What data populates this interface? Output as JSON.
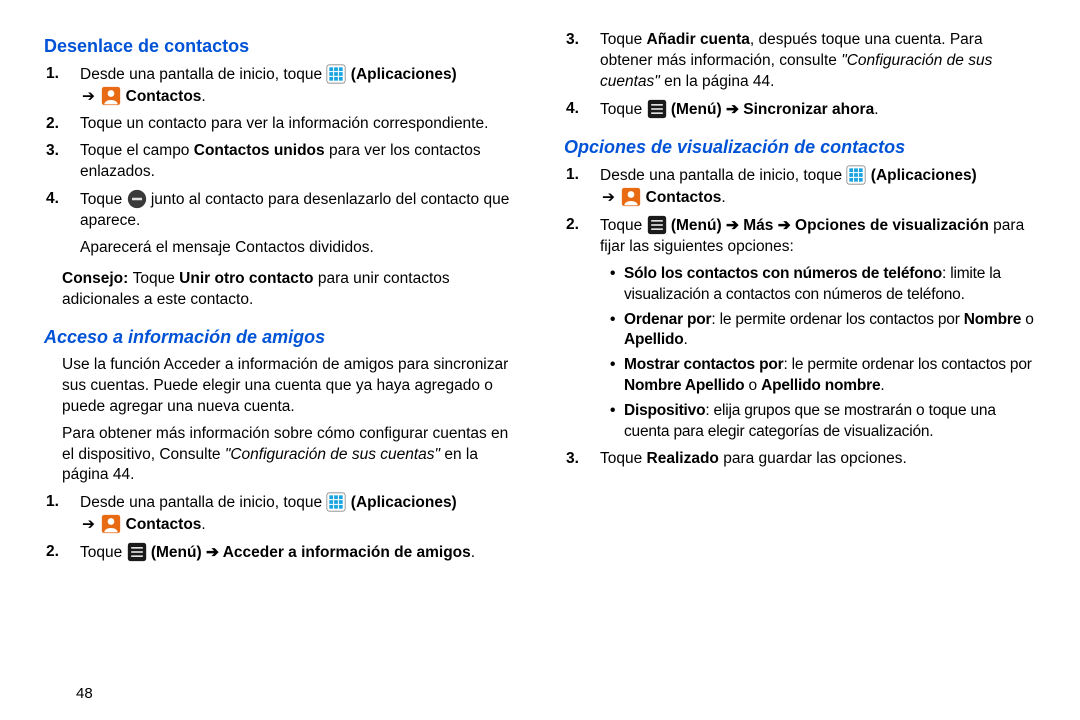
{
  "left": {
    "h1": "Desenlace de contactos",
    "s1_a": "Desde una pantalla de inicio, toque ",
    "s1_apps": " (Aplicaciones)",
    "s1_b": " ",
    "s1_cont": " Contactos",
    "s1_dot": ".",
    "s2": "Toque un contacto para ver la información correspondiente.",
    "s3_a": "Toque el campo ",
    "s3_b": "Contactos unidos",
    "s3_c": " para ver los contactos enlazados.",
    "s4_a": "Toque ",
    "s4_b": " junto al contacto para desenlazarlo del contacto que aparece.",
    "s4_msg": "Aparecerá el mensaje Contactos divididos.",
    "tip_label": "Consejo: ",
    "tip_a": "Toque ",
    "tip_b": "Unir otro contacto",
    "tip_c": " para unir contactos adicionales a este contacto.",
    "h2": "Acceso a información de amigos",
    "p1": "Use la función Acceder a información de amigos para sincronizar sus cuentas. Puede elegir una cuenta que ya haya agregado o puede agregar una nueva cuenta.",
    "p2_a": "Para obtener más información sobre cómo configurar cuentas en el dispositivo, Consulte ",
    "p2_b": "\"Configuración de sus cuentas\"",
    "p2_c": " en la página 44.",
    "s5_a": "Desde una pantalla de inicio, toque ",
    "s5_apps": " (Aplicaciones)",
    "s5_b": " ",
    "s5_cont": " Contactos",
    "s5_dot": ".",
    "s6_a": "Toque ",
    "s6_menu": " (Menú) ",
    "s6_b": " Acceder a información de amigos",
    "s6_dot": "."
  },
  "right": {
    "r3_a": "Toque ",
    "r3_b": "Añadir cuenta",
    "r3_c": ", después toque una cuenta. Para obtener más información, consulte ",
    "r3_d": "\"Configuración de sus cuentas\"",
    "r3_e": " en la página 44.",
    "r4_a": "Toque ",
    "r4_menu": " (Menú) ",
    "r4_b": " Sincronizar ahora",
    "r4_dot": ".",
    "h3": "Opciones de visualización de contactos",
    "s1_a": "Desde una pantalla de inicio, toque ",
    "s1_apps": " (Aplicaciones)",
    "s1_cont": " Contactos",
    "s1_dot": ".",
    "s2_a": "Toque ",
    "s2_menu": " (Menú) ",
    "s2_mas": " Más ",
    "s2_opt": " Opciones de visualización",
    "s2_b": " para fijar las siguientes opciones:",
    "b1_a": "Sólo los contactos con números de teléfono",
    "b1_b": ": limite la visualización a contactos con números de teléfono.",
    "b2_a": "Ordenar por",
    "b2_b": ": le permite ordenar los contactos por ",
    "b2_c": "Nombre",
    "b2_d": " o ",
    "b2_e": "Apellido",
    "b2_f": ".",
    "b3_a": "Mostrar contactos por",
    "b3_b": ": le permite ordenar los contactos por ",
    "b3_c": "Nombre Apellido",
    "b3_d": " o ",
    "b3_e": "Apellido nombre",
    "b3_f": ".",
    "b4_a": "Dispositivo",
    "b4_b": ": elija grupos que se mostrarán o toque una cuenta para elegir categorías de visualización.",
    "s3_a": "Toque ",
    "s3_b": "Realizado",
    "s3_c": " para guardar las opciones."
  },
  "pagenum": "48",
  "arrow": "➔"
}
